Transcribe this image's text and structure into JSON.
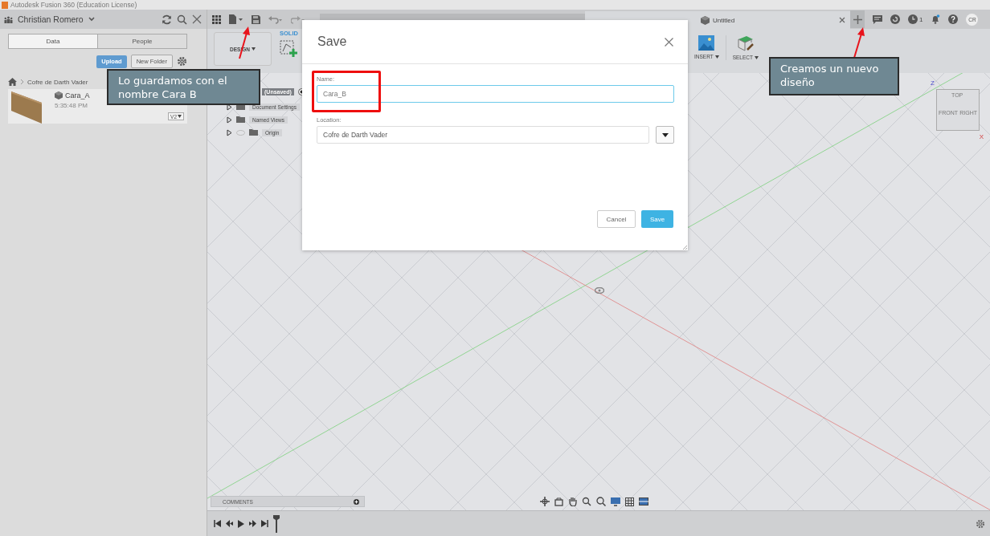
{
  "title_bar": {
    "title": "Autodesk Fusion 360 (Education License)"
  },
  "data_panel": {
    "user": "Christian Romero",
    "tabs": [
      {
        "label": "Data",
        "selected": true
      },
      {
        "label": "People",
        "selected": false
      }
    ],
    "upload": "Upload",
    "new_folder": "New Folder",
    "breadcrumb": "Cofre de Darth Vader",
    "files": [
      {
        "name": "Cara_A",
        "time": "5:35:48 PM",
        "version": "V2"
      }
    ]
  },
  "document_tabs": [
    {
      "title": "Untitled",
      "selected": true
    }
  ],
  "job_count": "1",
  "avatar": "CR",
  "ribbon": {
    "workspace": "DESIGN",
    "tabs": [
      {
        "label": "SOLID",
        "selected": true
      }
    ],
    "groups": [
      "INSERT",
      "SELECT"
    ]
  },
  "browser": {
    "root": "(Unsaved)",
    "items": [
      "Document Settings",
      "Named Views",
      "Origin"
    ]
  },
  "view_cube": {
    "faces": [
      "TOP",
      "FRONT",
      "RIGHT"
    ],
    "axes": [
      "Z",
      "X"
    ]
  },
  "dialog": {
    "title": "Save",
    "name_label": "Name:",
    "name_value": "Cara_B",
    "location_label": "Location:",
    "location_value": "Cofre de Darth Vader",
    "buttons": [
      {
        "label": "Cancel",
        "kind": "secondary"
      },
      {
        "label": "Save",
        "kind": "primary"
      }
    ]
  },
  "comments": {
    "label": "COMMENTS"
  },
  "annotations": [
    {
      "text": "Lo guardamos con el nombre Cara B"
    },
    {
      "text": "Creamos un nuevo diseño"
    }
  ]
}
